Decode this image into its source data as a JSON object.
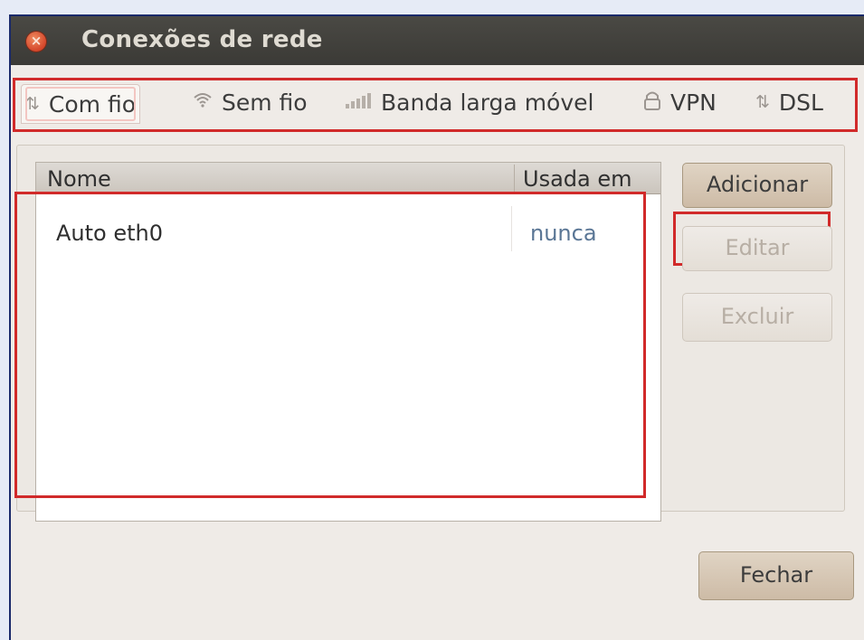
{
  "window": {
    "title": "Conexões de rede"
  },
  "tabs": [
    {
      "label": "Com fio",
      "icon": "wired-icon",
      "active": true
    },
    {
      "label": "Sem fio",
      "icon": "wireless-icon",
      "active": false
    },
    {
      "label": "Banda larga móvel",
      "icon": "mobile-broadband-icon",
      "active": false
    },
    {
      "label": "VPN",
      "icon": "vpn-lock-icon",
      "active": false
    },
    {
      "label": "DSL",
      "icon": "dsl-icon",
      "active": false
    }
  ],
  "connections": {
    "columns": {
      "name": "Nome",
      "used": "Usada em"
    },
    "rows": [
      {
        "name": "Auto eth0",
        "used": "nunca"
      }
    ]
  },
  "buttons": {
    "add": "Adicionar",
    "edit": "Editar",
    "delete": "Excluir",
    "close": "Fechar"
  },
  "colors": {
    "highlight": "#d12a2a",
    "titlebar": "#3b3a36",
    "window_bg": "#efebe7"
  }
}
